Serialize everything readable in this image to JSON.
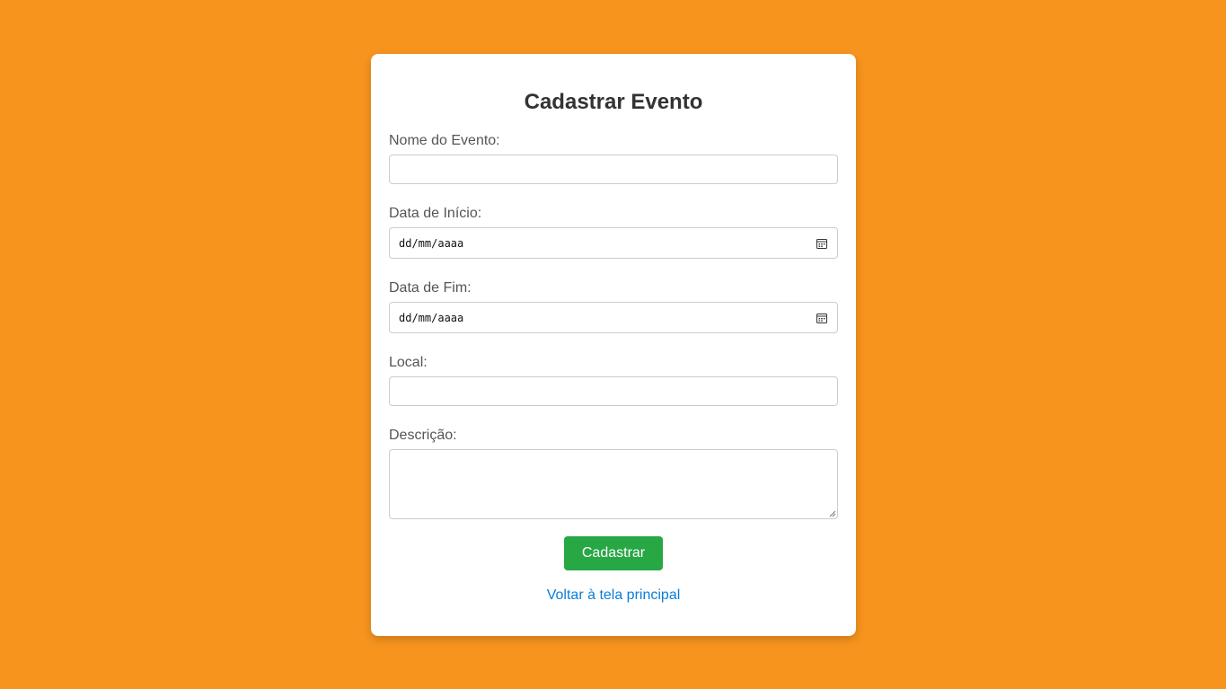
{
  "form": {
    "title": "Cadastrar Evento",
    "fields": {
      "nome": {
        "label": "Nome do Evento:",
        "value": ""
      },
      "inicio": {
        "label": "Data de Início:",
        "placeholder": "dd/mm/aaaa"
      },
      "fim": {
        "label": "Data de Fim:",
        "placeholder": "dd/mm/aaaa"
      },
      "local": {
        "label": "Local:",
        "value": ""
      },
      "descricao": {
        "label": "Descrição:",
        "value": ""
      }
    },
    "submit_label": "Cadastrar",
    "back_link": "Voltar à tela principal"
  },
  "colors": {
    "background": "#f7941e",
    "card": "#ffffff",
    "button": "#28a745",
    "link": "#0b7dd6"
  },
  "icons": {
    "date_picker": "calendar-icon",
    "textarea_resize": "resize-handle-icon"
  }
}
